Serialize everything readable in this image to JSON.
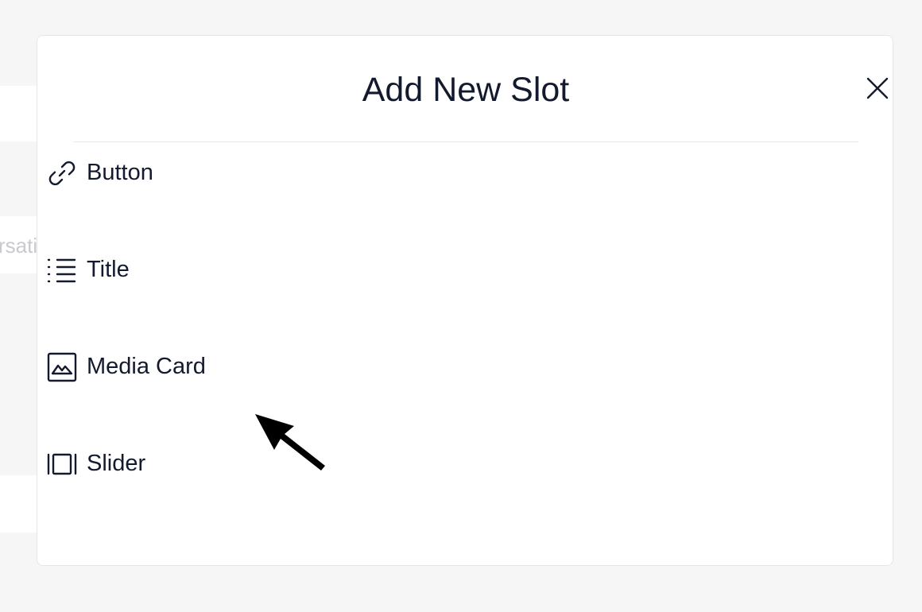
{
  "background": {
    "partial_text": "rsati"
  },
  "modal": {
    "title": "Add New Slot",
    "close_icon": "close-icon",
    "items": [
      {
        "label": "Button",
        "icon": "link-icon"
      },
      {
        "label": "Title",
        "icon": "list-icon"
      },
      {
        "label": "Media Card",
        "icon": "image-icon"
      },
      {
        "label": "Slider",
        "icon": "slider-icon"
      }
    ]
  },
  "colors": {
    "text": "#141a2e",
    "border": "#e6e6ea",
    "background": "#f7f6f7",
    "modal": "#ffffff"
  }
}
